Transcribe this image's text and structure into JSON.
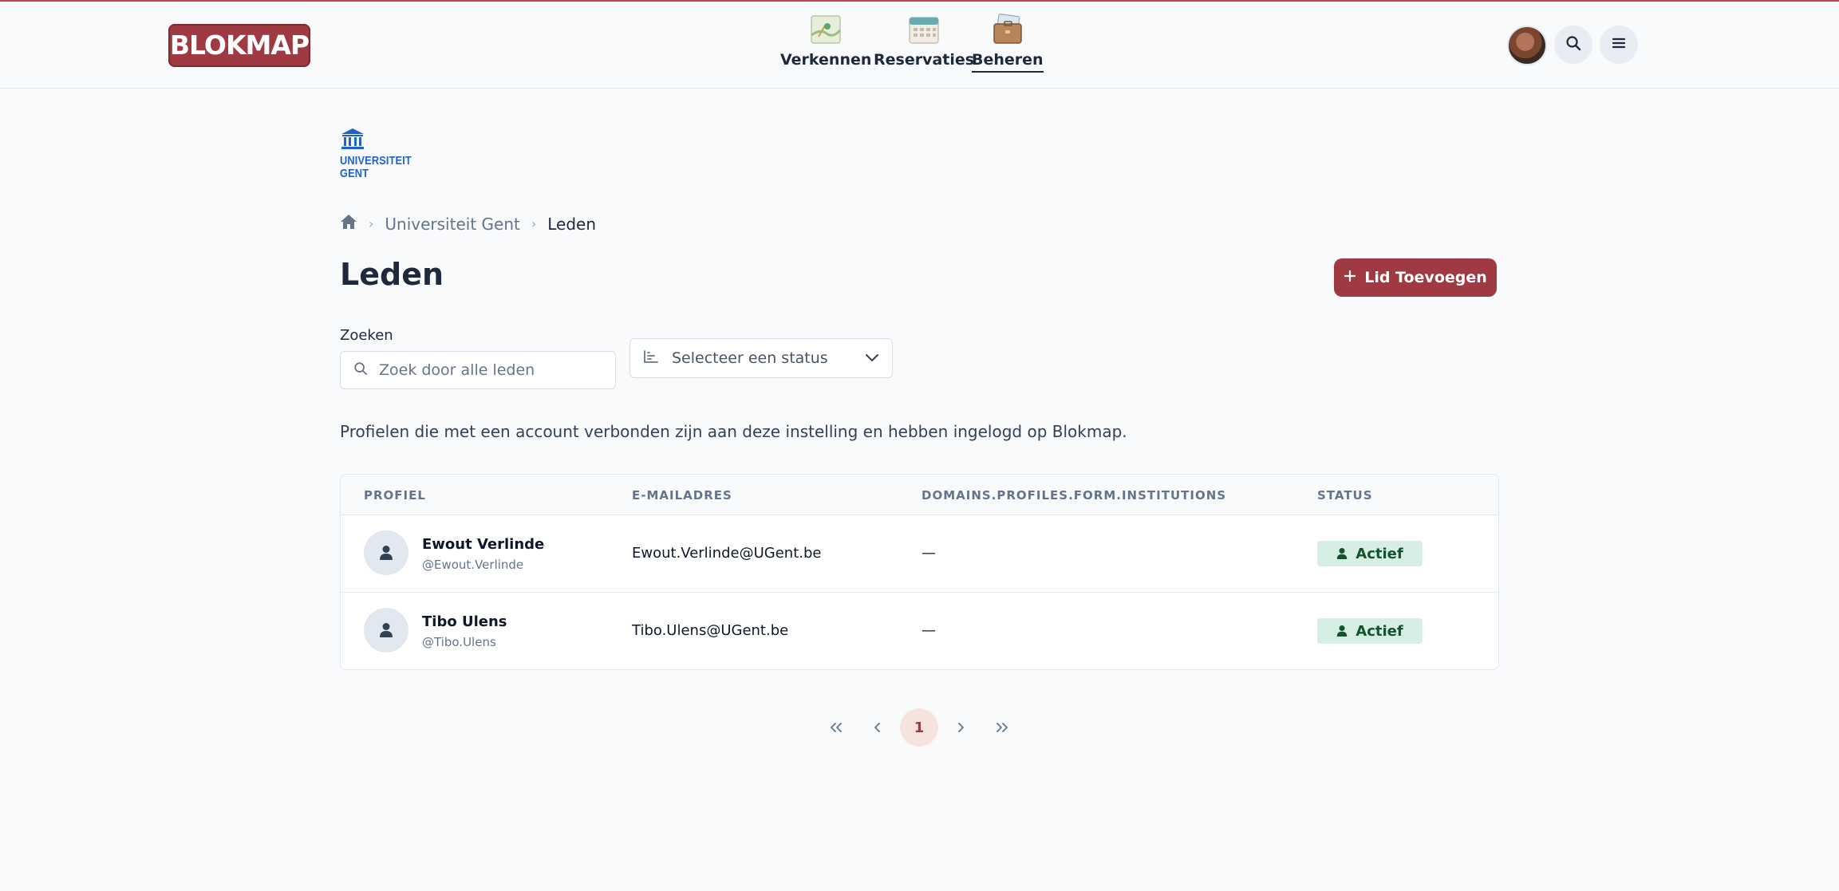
{
  "header": {
    "logo_text": "BLOKMAP",
    "nav": [
      {
        "label": "Verkennen",
        "icon": "map-icon"
      },
      {
        "label": "Reservaties",
        "icon": "calendar-icon"
      },
      {
        "label": "Beheren",
        "icon": "briefcase-icon",
        "active": true
      }
    ]
  },
  "institution": {
    "logo_text_line1": "UNIVERSITEIT",
    "logo_text_line2": "GENT"
  },
  "breadcrumb": {
    "items": [
      "Universiteit Gent",
      "Leden"
    ]
  },
  "page": {
    "title": "Leden",
    "add_button_label": "Lid Toevoegen",
    "search_label": "Zoeken",
    "search_placeholder": "Zoek door alle leden",
    "status_select_label": "Selecteer een status",
    "description": "Profielen die met een account verbonden zijn aan deze instelling en hebben ingelogd op Blokmap."
  },
  "table": {
    "headers": [
      "PROFIEL",
      "E-MAILADRES",
      "DOMAINS.PROFILES.FORM.INSTITUTIONS",
      "STATUS"
    ],
    "rows": [
      {
        "name": "Ewout Verlinde",
        "handle": "@Ewout.Verlinde",
        "email": "Ewout.Verlinde@UGent.be",
        "institutions": "—",
        "status": "Actief"
      },
      {
        "name": "Tibo Ulens",
        "handle": "@Tibo.Ulens",
        "email": "Tibo.Ulens@UGent.be",
        "institutions": "—",
        "status": "Actief"
      }
    ]
  },
  "pagination": {
    "current_page": "1"
  },
  "colors": {
    "brand": "#9f3a43",
    "status_active_bg": "#d6eee3",
    "status_active_text": "#14532d"
  }
}
